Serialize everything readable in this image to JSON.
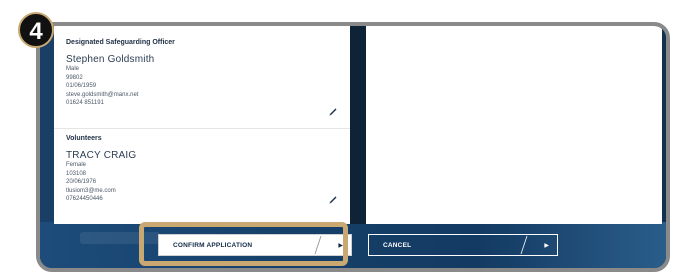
{
  "step_number": "4",
  "sections": [
    {
      "heading": "Designated Safeguarding Officer",
      "name": "Stephen Goldsmith",
      "gender": "Male",
      "id": "99802",
      "dob": "01/06/1959",
      "email": "steve.goldsmith@manx.net",
      "phone": "01624 851191"
    },
    {
      "heading": "Volunteers",
      "name": "TRACY CRAIG",
      "gender": "Female",
      "id": "103108",
      "dob": "20/06/1976",
      "email": "tlusiom3@me.com",
      "phone": "07624450446"
    }
  ],
  "buttons": {
    "confirm_label": "CONFIRM APPLICATION",
    "cancel_label": "CANCEL"
  },
  "colors": {
    "background": "#1f4a76",
    "highlight": "#c9a872",
    "badge": "#111111"
  }
}
